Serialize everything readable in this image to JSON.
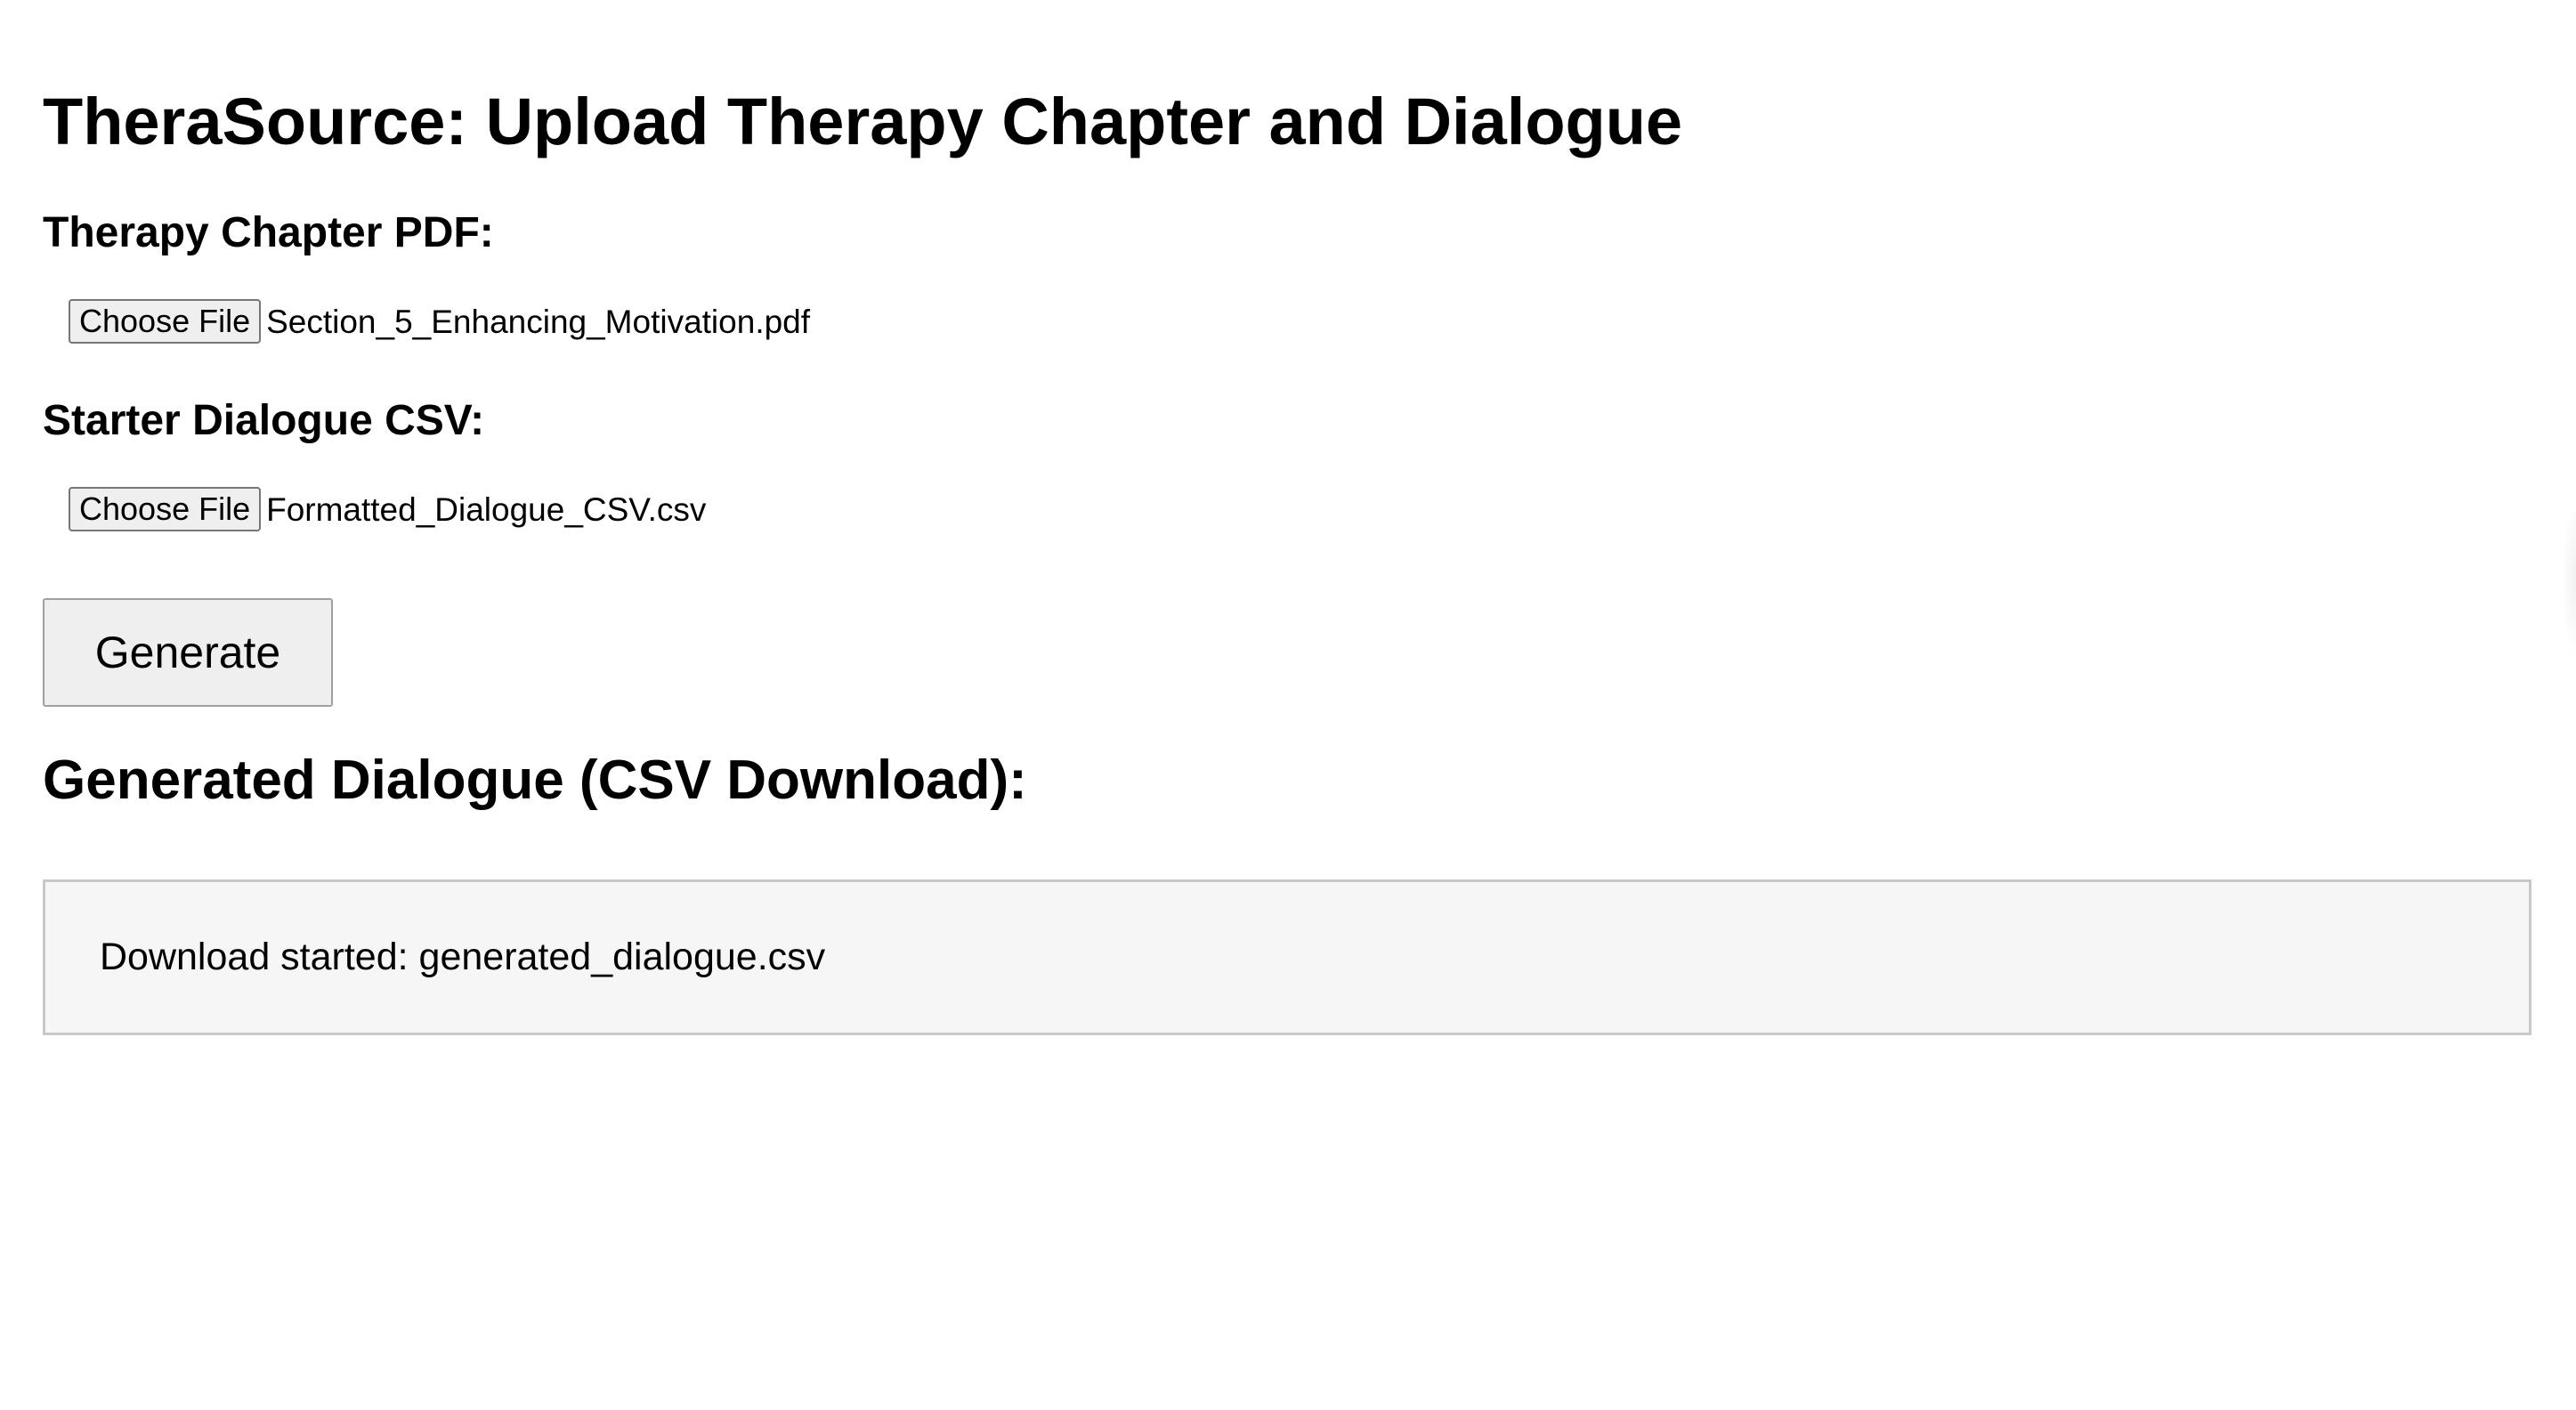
{
  "page": {
    "title": "TheraSource: Upload Therapy Chapter and Dialogue"
  },
  "form": {
    "pdf_section": {
      "label": "Therapy Chapter PDF:",
      "button_label": "Choose File",
      "file_name": "Section_5_Enhancing_Motivation.pdf"
    },
    "csv_section": {
      "label": "Starter Dialogue CSV:",
      "button_label": "Choose File",
      "file_name": "Formatted_Dialogue_CSV.csv"
    },
    "generate_label": "Generate"
  },
  "result": {
    "heading": "Generated Dialogue (CSV Download):",
    "message": "Download started: generated_dialogue.csv"
  },
  "colors": {
    "background": "#ffffff",
    "button_background": "#efefef",
    "output_background": "#f6f6f6",
    "output_border": "#c8c8c8",
    "text": "#000000"
  }
}
